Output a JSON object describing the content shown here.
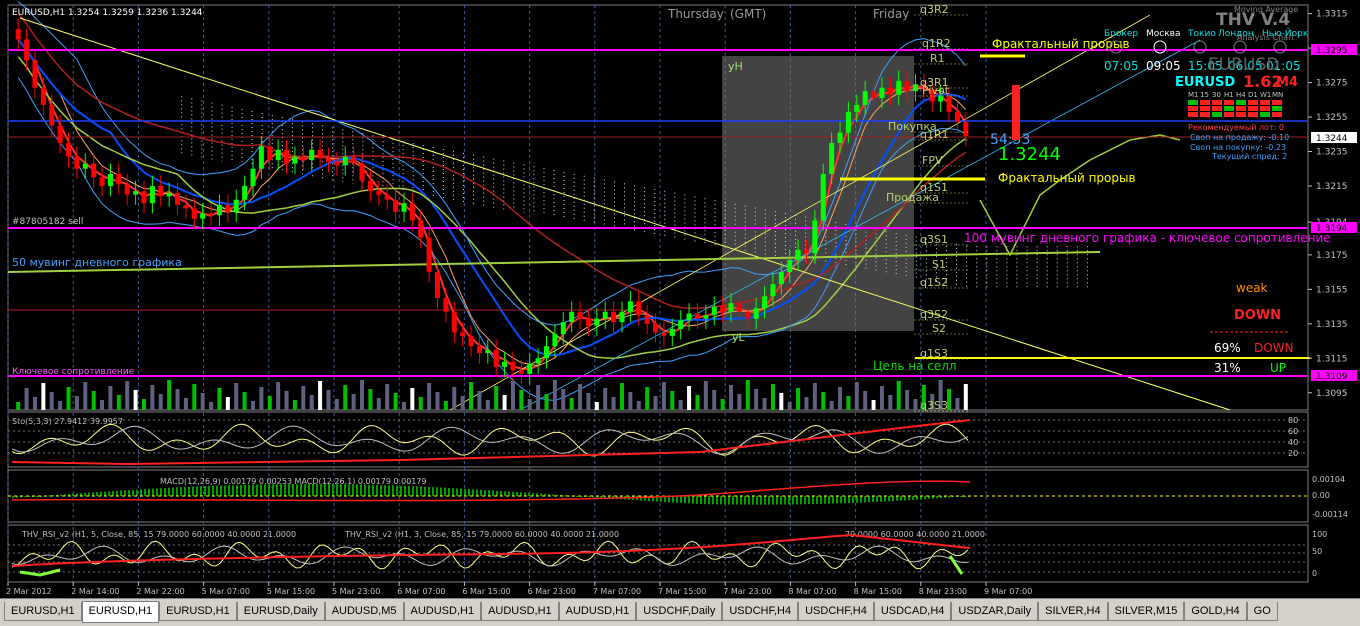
{
  "chart_data": {
    "type": "candlestick",
    "symbol_header": "EURUSD,H1  1.3254 1.3259 1.3236 1.3244",
    "y_ticks": [
      "1.3315",
      "1.3295",
      "1.3275",
      "1.3255",
      "1.3235",
      "1.3215",
      "1.3194",
      "1.3175",
      "1.3155",
      "1.3135",
      "1.3115",
      "1.3095"
    ],
    "x_ticks": [
      "2 Mar 2012",
      "2 Mar 14:00",
      "2 Mar 22:00",
      "5 Mar 07:00",
      "5 Mar 15:00",
      "5 Mar 23:00",
      "6 Mar 07:00",
      "6 Mar 15:00",
      "6 Mar 23:00",
      "7 Mar 07:00",
      "7 Mar 15:00",
      "7 Mar 23:00",
      "8 Mar 07:00",
      "8 Mar 15:00",
      "8 Mar 23:00",
      "9 Mar 07:00"
    ],
    "ylim": [
      1.3085,
      1.332
    ],
    "closes": [
      1.33,
      1.3288,
      1.3272,
      1.3262,
      1.325,
      1.324,
      1.3232,
      1.3225,
      1.3228,
      1.322,
      1.3215,
      1.3222,
      1.3216,
      1.321,
      1.3212,
      1.3205,
      1.3215,
      1.3209,
      1.3211,
      1.3204,
      1.3202,
      1.3196,
      1.3199,
      1.3198,
      1.3204,
      1.32,
      1.3207,
      1.3215,
      1.3225,
      1.3238,
      1.323,
      1.3236,
      1.3228,
      1.3232,
      1.323,
      1.3236,
      1.3231,
      1.3229,
      1.3227,
      1.3232,
      1.3228,
      1.3218,
      1.3212,
      1.321,
      1.3207,
      1.32,
      1.3205,
      1.3195,
      1.3185,
      1.3165,
      1.315,
      1.3142,
      1.313,
      1.3128,
      1.3122,
      1.3118,
      1.312,
      1.311,
      1.3113,
      1.3108,
      1.3106,
      1.3112,
      1.3115,
      1.3122,
      1.3129,
      1.3136,
      1.3142,
      1.3138,
      1.3134,
      1.3138,
      1.3142,
      1.3136,
      1.3142,
      1.3148,
      1.314,
      1.3135,
      1.313,
      1.3128,
      1.3132,
      1.3137,
      1.3141,
      1.3138,
      1.314,
      1.3145,
      1.3142,
      1.3147,
      1.3142,
      1.3138,
      1.3144,
      1.3151,
      1.3158,
      1.3165,
      1.3172,
      1.3178,
      1.3176,
      1.3195,
      1.3222,
      1.324,
      1.3246,
      1.3258,
      1.3262,
      1.327,
      1.3266,
      1.3272,
      1.3268,
      1.3276,
      1.327,
      1.3274,
      1.3271,
      1.3264,
      1.3267,
      1.3258,
      1.3252,
      1.3244
    ],
    "overlays": [
      {
        "name": "Фрактальный прорыв",
        "text_id": "fractal-label-top",
        "value": 1.3292,
        "color": "#ffff00"
      },
      {
        "name": "Фрактальный прорыв",
        "text_id": "fractal-label-mid",
        "value": 1.3221,
        "color": "#ffff00"
      },
      {
        "name": "100 мувинг дневного графика - ключевое сопротивление",
        "value": 1.3194,
        "color": "#ff00ff"
      },
      {
        "name": "Ключевое сопротивление",
        "value": 1.3109,
        "color": "#ff00ff"
      },
      {
        "name": "Цель на селл",
        "value": 1.3115,
        "color": "#ffff00"
      }
    ]
  },
  "header": {
    "symbol": "EURUSD,H1  1.3254 1.3259 1.3236 1.3244",
    "day1": "Thursday",
    "gmt": "(GMT)",
    "day2": "Friday"
  },
  "left_labels": {
    "order": "#87805182 sell",
    "ma50": "50 мувинг дневного графика",
    "key": "Ключевое сопротивление",
    "yh": "yH",
    "yl": "yL"
  },
  "pivot_labels": [
    "q3R2",
    "q1R2",
    "R1",
    "q3R1",
    "Pivot",
    "Покупка",
    "q1R1",
    "FPV",
    "q1S1",
    "Продажа",
    "q3S1",
    "S1",
    "q1S2",
    "q3S2",
    "S2",
    "q1S3",
    "q3S3"
  ],
  "annotations": {
    "fractal_top": "Фрактальный прорыв",
    "fractal_mid": "Фрактальный прорыв",
    "ma100": "100 мувинг дневного графика - ключевое сопротивление",
    "target": "Цель на селл",
    "timer": "54:53",
    "price": "1.3244"
  },
  "prices": {
    "p1295": "1.3295",
    "p1244": "1.3244",
    "p1194": "1.3194",
    "p1109": "1.3109"
  },
  "clocks": {
    "labels": [
      "Брокер",
      "Москва",
      "Токио",
      "Лондон",
      "Нью-Йорк"
    ],
    "broker": "07:05",
    "moscow": "09:05",
    "tokyo": "15:05",
    "london": "06:05",
    "ny": "01:05"
  },
  "panel": {
    "title": "THV V.4",
    "subtitle1": "Moving Average",
    "subtitle2": "Analysis Chart",
    "pair_overlay": "EURUSD",
    "pair": "EURUSD",
    "spread_big": "1.62",
    "spread_suffix": "M4",
    "timeframes": [
      "M1",
      "15",
      "30",
      "H1",
      "H4",
      "D1",
      "W1",
      "MN"
    ],
    "lot": "Рекомендуемый лот: 0",
    "swap_sell": "Своп на продажу: -0.10",
    "swap_buy": "Своп на покупку: -0.23",
    "spread": "Текущий спред: 2"
  },
  "trend": {
    "strength": "weak",
    "direction": "DOWN",
    "down_pct": "69%",
    "down_label": "DOWN",
    "up_pct": "31%",
    "up_label": "UP"
  },
  "stoch": {
    "label": "Sto(5,3,3) 27.9412 39.9957",
    "levels": [
      "80",
      "60",
      "40",
      "20"
    ]
  },
  "macd": {
    "label": "MACD(12,26,9) 0.00179 0.00253  MACD(12,26,1) 0.00179 0.00179",
    "ticks": [
      "0.00104",
      "0.00",
      "-0.00114"
    ]
  },
  "rsi": {
    "label1": "THV_RSI_v2 (H1, 5, Close, 85, 15 79.0000 60.0000 40.0000 21.0000",
    "label2": "THV_RSI_v2 (H1, 3, Close, 85, 15 79.0000 60.0000 40.0000 21.0000",
    "label3": "79.0000 60.0000 40.0000 21.0000",
    "ticks": [
      "100",
      "50",
      "0"
    ]
  },
  "tabs": [
    {
      "label": "EURUSD,H1",
      "active": false
    },
    {
      "label": "EURUSD,H1",
      "active": true
    },
    {
      "label": "EURUSD,H1",
      "active": false
    },
    {
      "label": "EURUSD,Daily",
      "active": false
    },
    {
      "label": "AUDUSD,M5",
      "active": false
    },
    {
      "label": "AUDUSD,H1",
      "active": false
    },
    {
      "label": "AUDUSD,H1",
      "active": false
    },
    {
      "label": "AUDUSD,H1",
      "active": false
    },
    {
      "label": "USDCHF,Daily",
      "active": false
    },
    {
      "label": "USDCHF,H4",
      "active": false
    },
    {
      "label": "USDCHF,H4",
      "active": false
    },
    {
      "label": "USDCAD,H4",
      "active": false
    },
    {
      "label": "USDZAR,Daily",
      "active": false
    },
    {
      "label": "SILVER,H4",
      "active": false
    },
    {
      "label": "SILVER,M15",
      "active": false
    },
    {
      "label": "GOLD,H4",
      "active": false
    },
    {
      "label": "GO",
      "active": false
    }
  ],
  "colors": {
    "bull": "#00ff00",
    "bear": "#ff0000",
    "grid": "#555555",
    "axis": "#c0c0c0",
    "magenta": "#ff00ff",
    "yellow": "#ffff00",
    "blue": "#0000ff",
    "cyan": "#00ffff"
  }
}
